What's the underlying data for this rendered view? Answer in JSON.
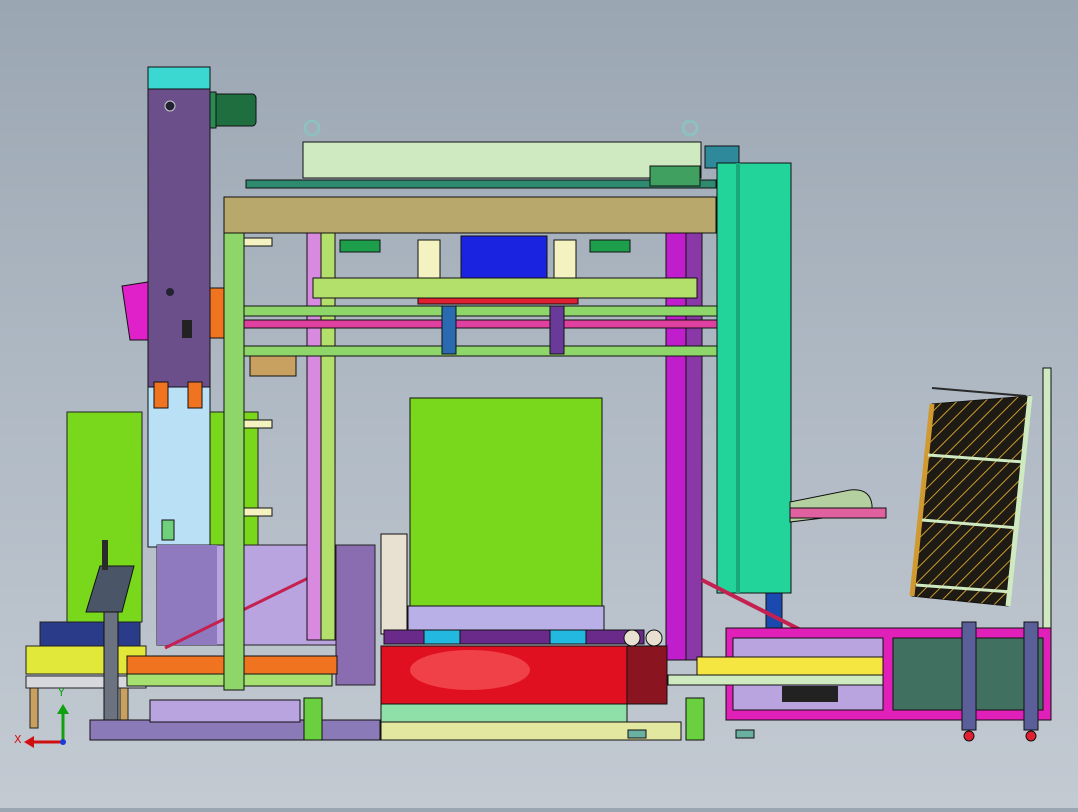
{
  "view": {
    "background_top": "#9aa6b2",
    "background_bottom": "#c3cad2"
  },
  "triad": {
    "x_label": "X",
    "y_label": "Y",
    "x_color": "#d01010",
    "y_color": "#10a010"
  },
  "palette": {
    "column_purple": "#6a4f8a",
    "gantry_tan": "#b9a86c",
    "teal_column": "#22d39a",
    "lime_panel": "#7ad81c",
    "magenta_frame": "#c01ecc",
    "red_turntable": "#e01020",
    "blue_box": "#1a24e0",
    "motor_green": "#1f6e3f",
    "base_pink": "#e020b8"
  }
}
